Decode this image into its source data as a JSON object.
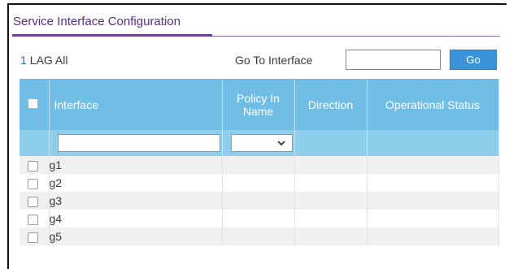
{
  "section": {
    "title": "Service Interface Configuration"
  },
  "scope": {
    "count": "1",
    "label": "LAG All"
  },
  "goto": {
    "label": "Go To Interface",
    "value": "",
    "button_label": "Go"
  },
  "table": {
    "columns": [
      "Interface",
      "Policy In Name",
      "Direction",
      "Operational Status"
    ],
    "rows": [
      {
        "interface": "g1"
      },
      {
        "interface": "g2"
      },
      {
        "interface": "g3"
      },
      {
        "interface": "g4"
      },
      {
        "interface": "g5"
      }
    ]
  },
  "icons": {
    "dropdown": "chevron-down-icon"
  },
  "colors": {
    "header_blue": "#70bde6",
    "button_blue": "#3b93d8",
    "title_purple": "#5a2d81"
  }
}
